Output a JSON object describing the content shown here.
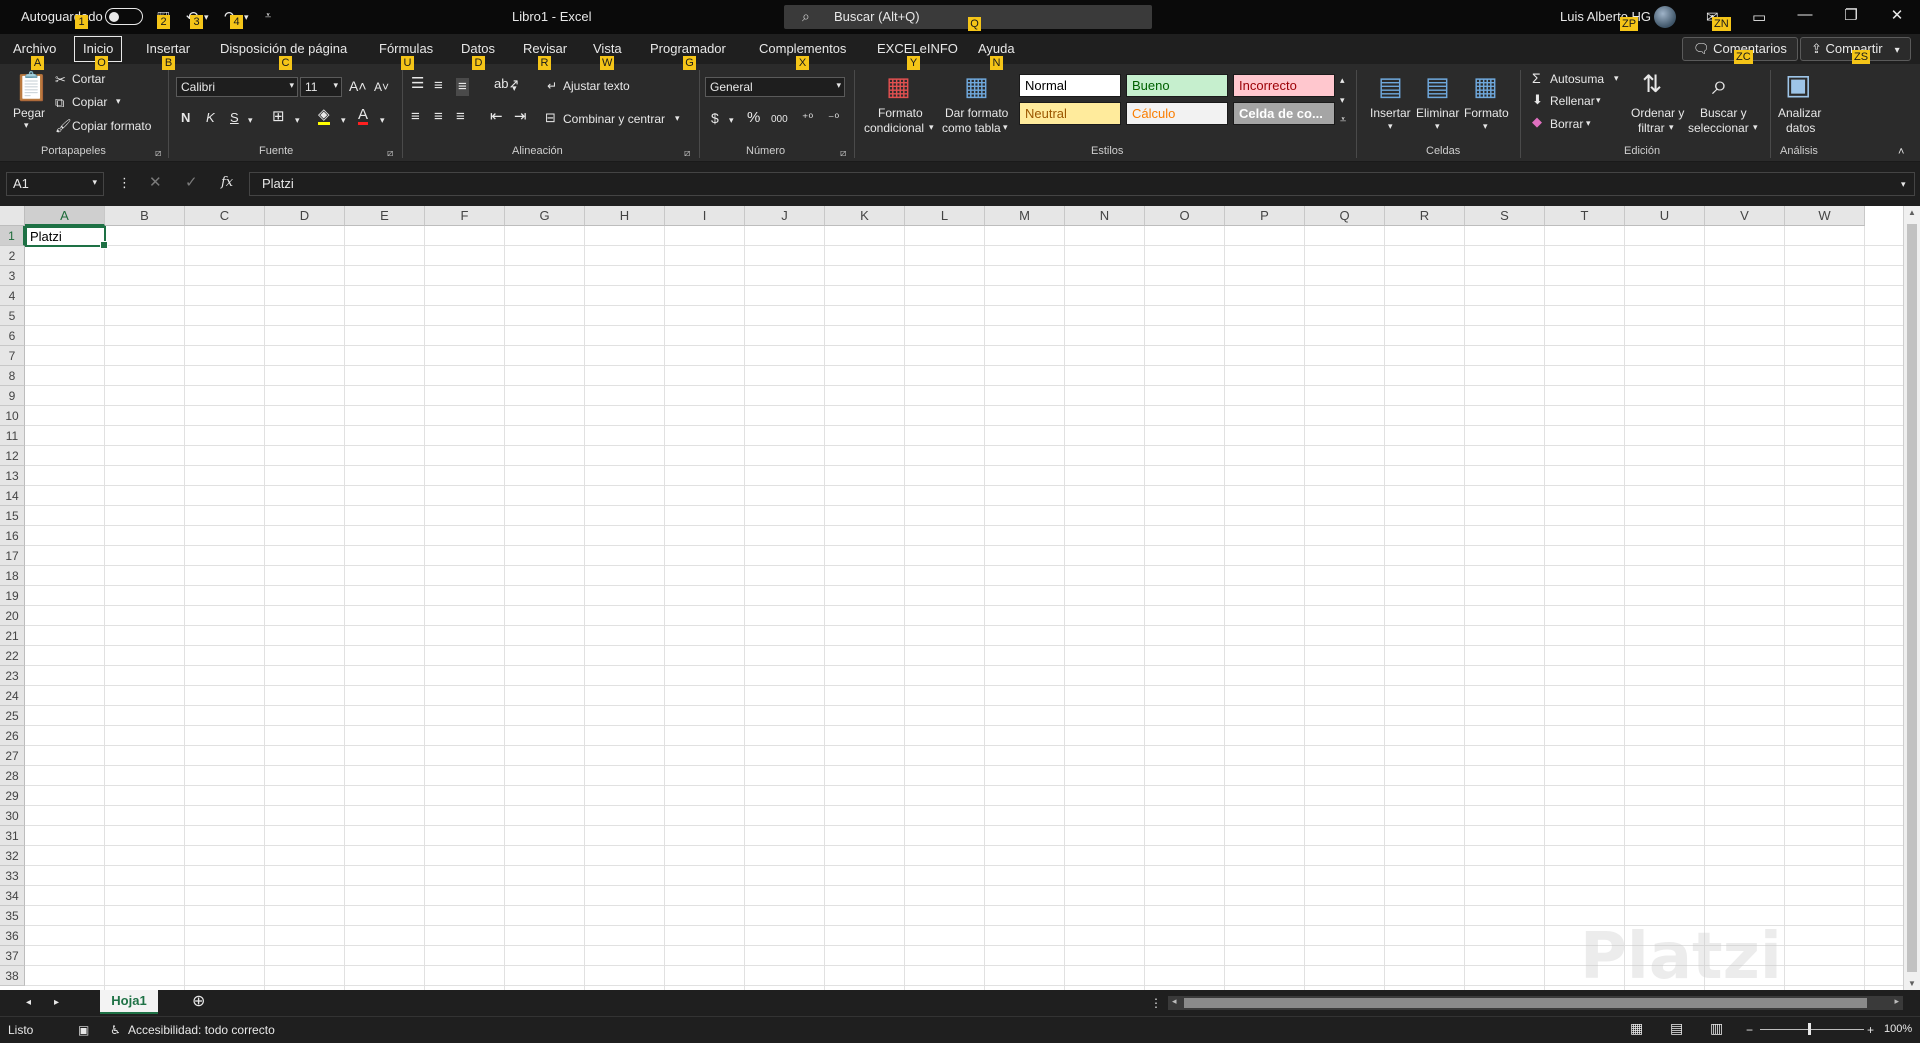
{
  "titlebar": {
    "autosave_label": "Autoguardado",
    "doc_title": "Libro1  -  Excel",
    "search_placeholder": "Buscar (Alt+Q)",
    "user_name": "Luis Alberto HG",
    "window_buttons": {
      "minimize": "—",
      "restore": "❐",
      "close": "✕"
    }
  },
  "keytips": {
    "autosave": "1",
    "save": "2",
    "undo": "3",
    "redo": "4",
    "search": "Q",
    "archivo": "A",
    "inicio": "O",
    "insertar": "B",
    "disposicion": "C",
    "formulas": "U",
    "datos": "D",
    "revisar": "R",
    "vista": "W",
    "programador": "G",
    "complementos": "X",
    "excelinfo": "Y",
    "ayuda": "N",
    "profile": "ZP",
    "notify": "ZN",
    "comments": "ZC",
    "share": "ZS"
  },
  "tabs": [
    "Archivo",
    "Inicio",
    "Insertar",
    "Disposición de página",
    "Fórmulas",
    "Datos",
    "Revisar",
    "Vista",
    "Programador",
    "Complementos",
    "EXCELeINFO",
    "Ayuda"
  ],
  "active_tab": "Inicio",
  "top_buttons": {
    "comments": "Comentarios",
    "share": "Compartir"
  },
  "ribbon": {
    "clipboard": {
      "paste": "Pegar",
      "cut": "Cortar",
      "copy": "Copiar",
      "format_painter": "Copiar formato",
      "label": "Portapapeles"
    },
    "font": {
      "name": "Calibri",
      "size": "11",
      "bold": "N",
      "italic": "K",
      "underline": "S",
      "font_color_letter": "A",
      "label": "Fuente"
    },
    "alignment": {
      "wrap": "Ajustar texto",
      "merge": "Combinar y centrar",
      "label": "Alineación"
    },
    "number": {
      "format": "General",
      "currency": "$",
      "percent": "%",
      "thousands": "000",
      "label": "Número"
    },
    "styles": {
      "cond_format_line1": "Formato",
      "cond_format_line2": "condicional",
      "table_format_line1": "Dar formato",
      "table_format_line2": "como tabla",
      "cells": [
        {
          "label": "Normal",
          "bg": "#ffffff",
          "fg": "#000000"
        },
        {
          "label": "Bueno",
          "bg": "#c6efce",
          "fg": "#006100"
        },
        {
          "label": "Incorrecto",
          "bg": "#ffc7ce",
          "fg": "#9c0006"
        },
        {
          "label": "Neutral",
          "bg": "#ffeb9c",
          "fg": "#9c5700"
        },
        {
          "label": "Cálculo",
          "bg": "#f2f2f2",
          "fg": "#fa7d00"
        },
        {
          "label": "Celda de co...",
          "bg": "#a5a5a5",
          "fg": "#ffffff"
        }
      ],
      "label": "Estilos"
    },
    "cells": {
      "insert": "Insertar",
      "delete": "Eliminar",
      "format": "Formato",
      "label": "Celdas"
    },
    "editing": {
      "autosum": "Autosuma",
      "fill": "Rellenar",
      "clear": "Borrar",
      "sort_line1": "Ordenar y",
      "sort_line2": "filtrar",
      "find_line1": "Buscar y",
      "find_line2": "seleccionar",
      "label": "Edición"
    },
    "analysis": {
      "analyze_line1": "Analizar",
      "analyze_line2": "datos",
      "label": "Análisis"
    }
  },
  "formula_bar": {
    "name_box": "A1",
    "fx": "fx",
    "value": "Platzi"
  },
  "grid": {
    "columns": [
      "A",
      "B",
      "C",
      "D",
      "E",
      "F",
      "G",
      "H",
      "I",
      "J",
      "K",
      "L",
      "M",
      "N",
      "O",
      "P",
      "Q",
      "R",
      "S",
      "T",
      "U",
      "V",
      "W"
    ],
    "rows": [
      "1",
      "2",
      "3",
      "4",
      "5",
      "6",
      "7",
      "8",
      "9",
      "10",
      "11",
      "12",
      "13",
      "14",
      "15",
      "16",
      "17",
      "18",
      "19",
      "20",
      "21",
      "22",
      "23",
      "24",
      "25",
      "26",
      "27",
      "28",
      "29",
      "30",
      "31",
      "32",
      "33",
      "34",
      "35",
      "36",
      "37",
      "38"
    ],
    "active_cell_value": "Platzi"
  },
  "sheet_tab": "Hoja1",
  "status": {
    "ready": "Listo",
    "accessibility": "Accesibilidad: todo correcto",
    "zoom": "100%"
  },
  "watermark": "Platzi"
}
